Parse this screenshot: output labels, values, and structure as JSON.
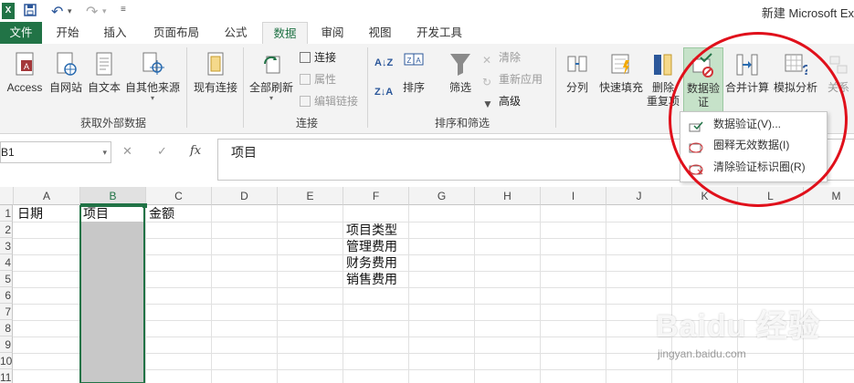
{
  "window": {
    "title": "新建 Microsoft Ex"
  },
  "tabs": [
    "文件",
    "开始",
    "插入",
    "页面布局",
    "公式",
    "数据",
    "审阅",
    "视图",
    "开发工具"
  ],
  "ribbon": {
    "get_external": {
      "buttons": [
        "Access",
        "自网站",
        "自文本",
        "自其他来源"
      ],
      "label": "获取外部数据"
    },
    "existing_conn": "现有连接",
    "connections": {
      "refresh_all": "全部刷新",
      "items": [
        "连接",
        "属性",
        "编辑链接"
      ],
      "label": "连接"
    },
    "sort_filter": {
      "sort": "排序",
      "filter": "筛选",
      "items": [
        "清除",
        "重新应用",
        "高级"
      ],
      "label": "排序和筛选"
    },
    "data_tools": {
      "split": "分列",
      "flash_fill": "快速填充",
      "remove_dup": "删除\n重复项",
      "validation": "数据验\n证",
      "consolidate": "合并计算",
      "whatif": "模拟分析",
      "relation": "关系"
    }
  },
  "dropdown": [
    "数据验证(V)...",
    "圈释无效数据(I)",
    "清除验证标识圈(R)"
  ],
  "formula_bar": {
    "name_box": "B1",
    "cancel": "✕",
    "enter": "✓",
    "fx": "fx",
    "value": "项目"
  },
  "grid": {
    "columns": [
      "A",
      "B",
      "C",
      "D",
      "E",
      "F",
      "G",
      "H",
      "I",
      "J",
      "K",
      "L",
      "M"
    ],
    "rows": [
      "1",
      "2",
      "3",
      "4",
      "5",
      "6",
      "7",
      "8",
      "9",
      "10",
      "11"
    ],
    "header_row": [
      "日期",
      "项目",
      "金额"
    ],
    "f_list": [
      "项目类型",
      "管理费用",
      "财务费用",
      "销售费用"
    ]
  },
  "watermark": {
    "brand": "Baidu 经验",
    "url": "jingyan.baidu.com"
  },
  "colors": {
    "excel_green": "#217346",
    "highlight": "#c6e2c9",
    "selection_fill": "#c8c8c8",
    "annotation_red": "#e0101b"
  }
}
